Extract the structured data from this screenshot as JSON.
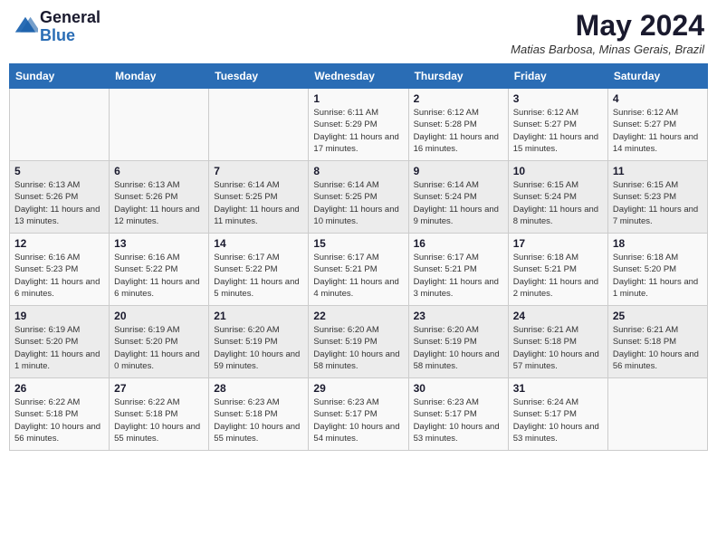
{
  "header": {
    "logo_line1": "General",
    "logo_line2": "Blue",
    "month_title": "May 2024",
    "subtitle": "Matias Barbosa, Minas Gerais, Brazil"
  },
  "weekdays": [
    "Sunday",
    "Monday",
    "Tuesday",
    "Wednesday",
    "Thursday",
    "Friday",
    "Saturday"
  ],
  "weeks": [
    [
      {
        "day": "",
        "info": ""
      },
      {
        "day": "",
        "info": ""
      },
      {
        "day": "",
        "info": ""
      },
      {
        "day": "1",
        "info": "Sunrise: 6:11 AM\nSunset: 5:29 PM\nDaylight: 11 hours and 17 minutes."
      },
      {
        "day": "2",
        "info": "Sunrise: 6:12 AM\nSunset: 5:28 PM\nDaylight: 11 hours and 16 minutes."
      },
      {
        "day": "3",
        "info": "Sunrise: 6:12 AM\nSunset: 5:27 PM\nDaylight: 11 hours and 15 minutes."
      },
      {
        "day": "4",
        "info": "Sunrise: 6:12 AM\nSunset: 5:27 PM\nDaylight: 11 hours and 14 minutes."
      }
    ],
    [
      {
        "day": "5",
        "info": "Sunrise: 6:13 AM\nSunset: 5:26 PM\nDaylight: 11 hours and 13 minutes."
      },
      {
        "day": "6",
        "info": "Sunrise: 6:13 AM\nSunset: 5:26 PM\nDaylight: 11 hours and 12 minutes."
      },
      {
        "day": "7",
        "info": "Sunrise: 6:14 AM\nSunset: 5:25 PM\nDaylight: 11 hours and 11 minutes."
      },
      {
        "day": "8",
        "info": "Sunrise: 6:14 AM\nSunset: 5:25 PM\nDaylight: 11 hours and 10 minutes."
      },
      {
        "day": "9",
        "info": "Sunrise: 6:14 AM\nSunset: 5:24 PM\nDaylight: 11 hours and 9 minutes."
      },
      {
        "day": "10",
        "info": "Sunrise: 6:15 AM\nSunset: 5:24 PM\nDaylight: 11 hours and 8 minutes."
      },
      {
        "day": "11",
        "info": "Sunrise: 6:15 AM\nSunset: 5:23 PM\nDaylight: 11 hours and 7 minutes."
      }
    ],
    [
      {
        "day": "12",
        "info": "Sunrise: 6:16 AM\nSunset: 5:23 PM\nDaylight: 11 hours and 6 minutes."
      },
      {
        "day": "13",
        "info": "Sunrise: 6:16 AM\nSunset: 5:22 PM\nDaylight: 11 hours and 6 minutes."
      },
      {
        "day": "14",
        "info": "Sunrise: 6:17 AM\nSunset: 5:22 PM\nDaylight: 11 hours and 5 minutes."
      },
      {
        "day": "15",
        "info": "Sunrise: 6:17 AM\nSunset: 5:21 PM\nDaylight: 11 hours and 4 minutes."
      },
      {
        "day": "16",
        "info": "Sunrise: 6:17 AM\nSunset: 5:21 PM\nDaylight: 11 hours and 3 minutes."
      },
      {
        "day": "17",
        "info": "Sunrise: 6:18 AM\nSunset: 5:21 PM\nDaylight: 11 hours and 2 minutes."
      },
      {
        "day": "18",
        "info": "Sunrise: 6:18 AM\nSunset: 5:20 PM\nDaylight: 11 hours and 1 minute."
      }
    ],
    [
      {
        "day": "19",
        "info": "Sunrise: 6:19 AM\nSunset: 5:20 PM\nDaylight: 11 hours and 1 minute."
      },
      {
        "day": "20",
        "info": "Sunrise: 6:19 AM\nSunset: 5:20 PM\nDaylight: 11 hours and 0 minutes."
      },
      {
        "day": "21",
        "info": "Sunrise: 6:20 AM\nSunset: 5:19 PM\nDaylight: 10 hours and 59 minutes."
      },
      {
        "day": "22",
        "info": "Sunrise: 6:20 AM\nSunset: 5:19 PM\nDaylight: 10 hours and 58 minutes."
      },
      {
        "day": "23",
        "info": "Sunrise: 6:20 AM\nSunset: 5:19 PM\nDaylight: 10 hours and 58 minutes."
      },
      {
        "day": "24",
        "info": "Sunrise: 6:21 AM\nSunset: 5:18 PM\nDaylight: 10 hours and 57 minutes."
      },
      {
        "day": "25",
        "info": "Sunrise: 6:21 AM\nSunset: 5:18 PM\nDaylight: 10 hours and 56 minutes."
      }
    ],
    [
      {
        "day": "26",
        "info": "Sunrise: 6:22 AM\nSunset: 5:18 PM\nDaylight: 10 hours and 56 minutes."
      },
      {
        "day": "27",
        "info": "Sunrise: 6:22 AM\nSunset: 5:18 PM\nDaylight: 10 hours and 55 minutes."
      },
      {
        "day": "28",
        "info": "Sunrise: 6:23 AM\nSunset: 5:18 PM\nDaylight: 10 hours and 55 minutes."
      },
      {
        "day": "29",
        "info": "Sunrise: 6:23 AM\nSunset: 5:17 PM\nDaylight: 10 hours and 54 minutes."
      },
      {
        "day": "30",
        "info": "Sunrise: 6:23 AM\nSunset: 5:17 PM\nDaylight: 10 hours and 53 minutes."
      },
      {
        "day": "31",
        "info": "Sunrise: 6:24 AM\nSunset: 5:17 PM\nDaylight: 10 hours and 53 minutes."
      },
      {
        "day": "",
        "info": ""
      }
    ]
  ]
}
